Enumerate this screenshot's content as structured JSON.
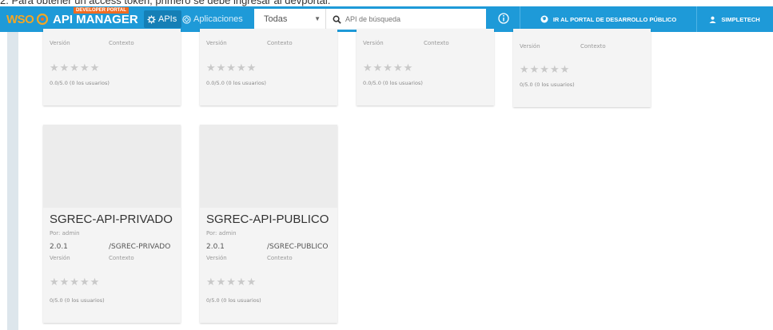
{
  "document_line": "2. Para obtener un access token, primero se debe ingresar al devportal.",
  "header": {
    "logo_wso2": "WSO",
    "logo_title": "API MANAGER",
    "logo_badge": "DEVELOPER PORTAL",
    "nav_apis": "APIs",
    "nav_apps": "Aplicaciones",
    "filter_value": "Todas",
    "search_placeholder": "API de búsqueda",
    "portal_link": "IR AL PORTAL DE DESARROLLO PÚBLICO",
    "user": "SIMPLETECH"
  },
  "top_cards": [
    {
      "version_label": "Versión",
      "context_label": "Contexto",
      "stars": "★★★★★",
      "rating": "0.0/5.0 (0 los usuarios)"
    },
    {
      "version_label": "Versión",
      "context_label": "Contexto",
      "stars": "★★★★★",
      "rating": "0.0/5.0 (0 los usuarios)"
    },
    {
      "version_label": "Versión",
      "context_label": "Contexto",
      "stars": "★★★★★",
      "rating": "0.0/5.0 (0 los usuarios)"
    },
    {
      "version_label": "Versión",
      "context_label": "Contexto",
      "stars": "★★★★★",
      "rating": "0/5.0 (0 los usuarios)"
    }
  ],
  "cards": [
    {
      "name": "SGREC-API-PRIVADO",
      "by": "Por: admin",
      "version": "2.0.1",
      "context": "/SGREC-PRIVADO",
      "version_label": "Versión",
      "context_label": "Contexto",
      "stars": "★★★★★",
      "rating": "0/5.0 (0 los usuarios)"
    },
    {
      "name": "SGREC-API-PUBLICO",
      "by": "Por: admin",
      "version": "2.0.1",
      "context": "/SGREC-PUBLICO",
      "version_label": "Versión",
      "context_label": "Contexto",
      "stars": "★★★★★",
      "rating": "0/5.0 (0 los usuarios)"
    }
  ],
  "colors": {
    "topbar": "#1e9ad8",
    "accent_orange": "#f26b21"
  }
}
